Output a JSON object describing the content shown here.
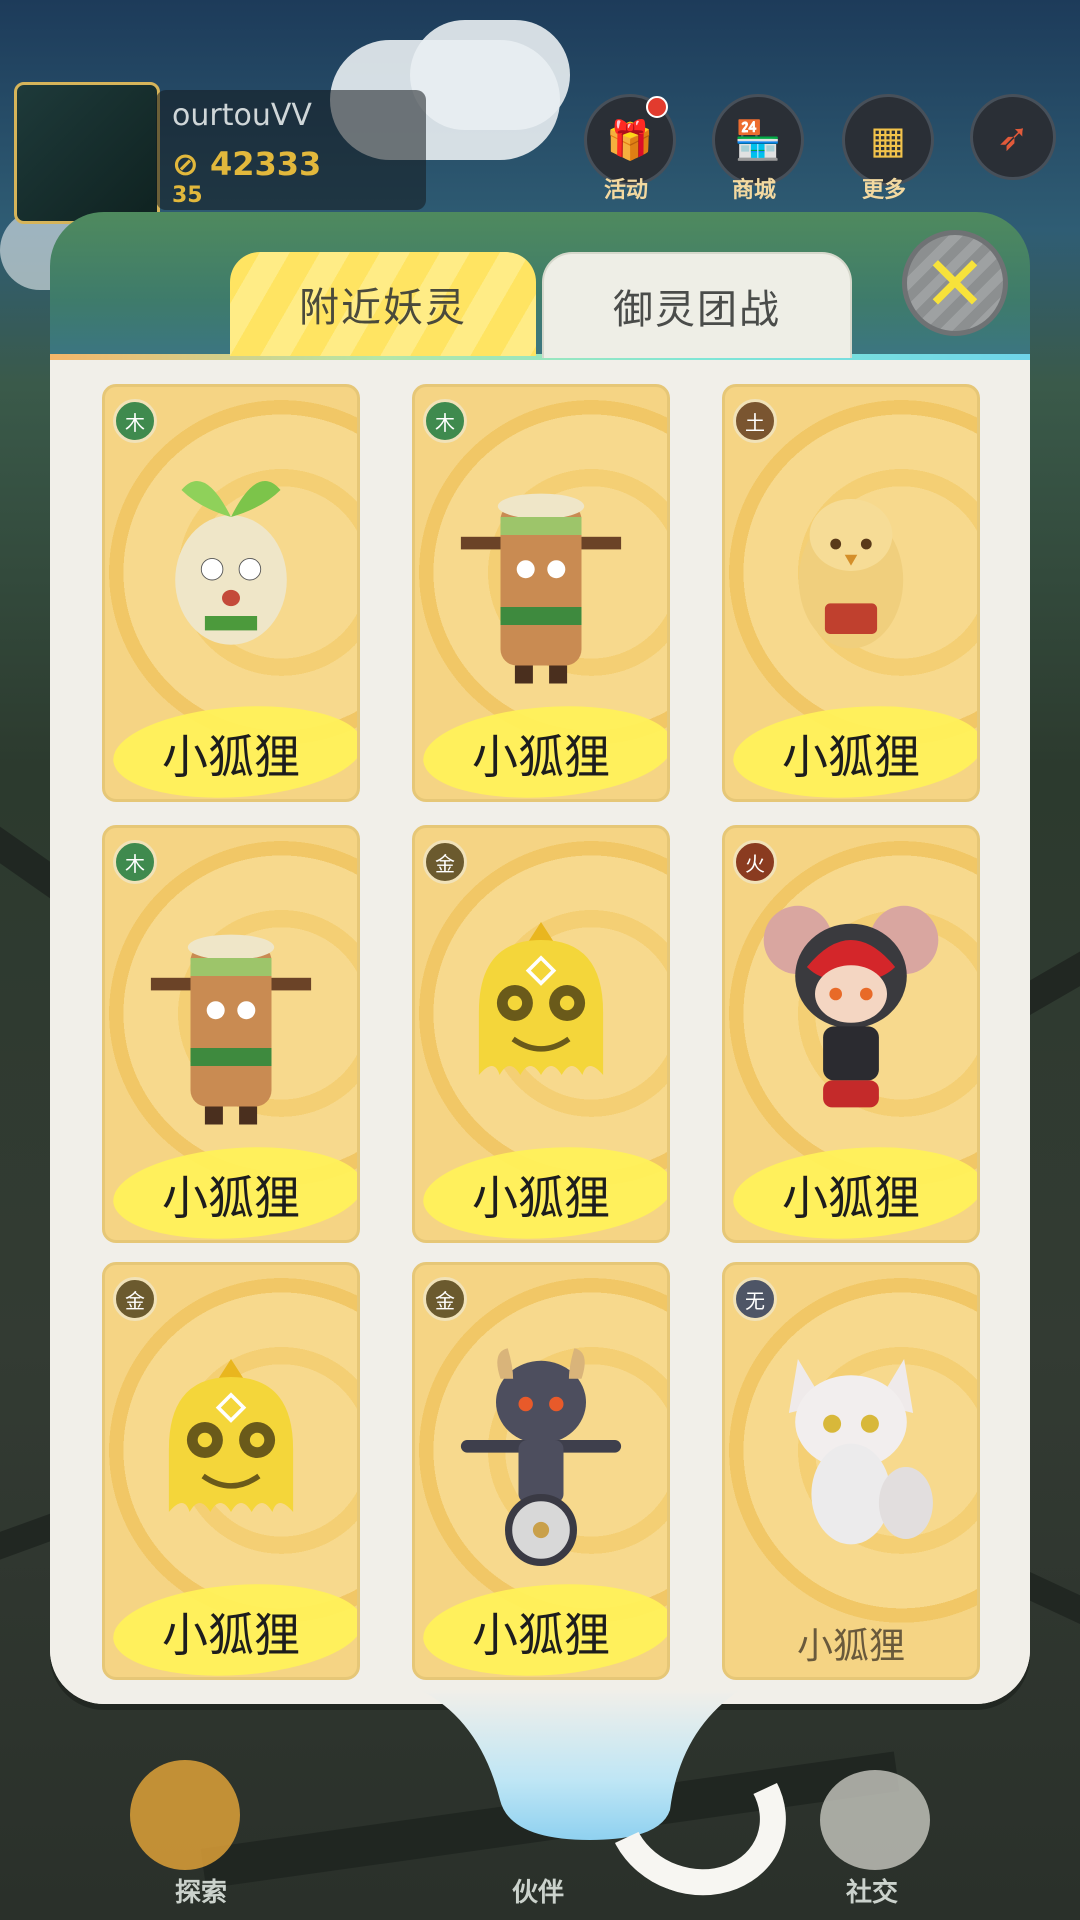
{
  "hud": {
    "player_name": "ourtouVV",
    "coins": "42333",
    "level": "35",
    "buttons": [
      {
        "label": "活动",
        "icon": "gift-icon"
      },
      {
        "label": "商城",
        "icon": "shop-icon"
      },
      {
        "label": "更多",
        "icon": "grid-icon"
      },
      {
        "label": "",
        "icon": "compass-icon"
      }
    ]
  },
  "tabs": [
    {
      "label": "附近妖灵",
      "active": true
    },
    {
      "label": "御灵团战",
      "active": false
    }
  ],
  "close_label": "✕",
  "cards": [
    {
      "element": "木",
      "element_type": "wood",
      "name": "小狐狸",
      "highlighted": true,
      "creature": "sprout-creature"
    },
    {
      "element": "木",
      "element_type": "wood",
      "name": "小狐狸",
      "highlighted": true,
      "creature": "tree-stump-creature"
    },
    {
      "element": "土",
      "element_type": "earth",
      "name": "小狐狸",
      "highlighted": true,
      "creature": "yellow-bird-creature"
    },
    {
      "element": "木",
      "element_type": "wood",
      "name": "小狐狸",
      "highlighted": true,
      "creature": "tree-stump-creature"
    },
    {
      "element": "金",
      "element_type": "metal",
      "name": "小狐狸",
      "highlighted": true,
      "creature": "gold-ghost-creature"
    },
    {
      "element": "火",
      "element_type": "fire",
      "name": "小狐狸",
      "highlighted": true,
      "creature": "red-ninja-mouse-creature"
    },
    {
      "element": "金",
      "element_type": "metal",
      "name": "小狐狸",
      "highlighted": true,
      "creature": "gold-ghost-creature"
    },
    {
      "element": "金",
      "element_type": "metal",
      "name": "小狐狸",
      "highlighted": true,
      "creature": "wheel-demon-creature"
    },
    {
      "element": "无",
      "element_type": "none",
      "name": "小狐狸",
      "highlighted": false,
      "creature": "white-fox-creature"
    }
  ],
  "bottom_nav": [
    {
      "label": "探索",
      "icon": "map-pin-icon"
    },
    {
      "label": "伙伴",
      "icon": "partner-icon"
    },
    {
      "label": "社交",
      "icon": "social-icon"
    }
  ],
  "colors": {
    "tab_active": "#ffe462",
    "highlight": "#fff15a",
    "card_bg": "#f7d98d",
    "close_x": "#f7e23a"
  }
}
